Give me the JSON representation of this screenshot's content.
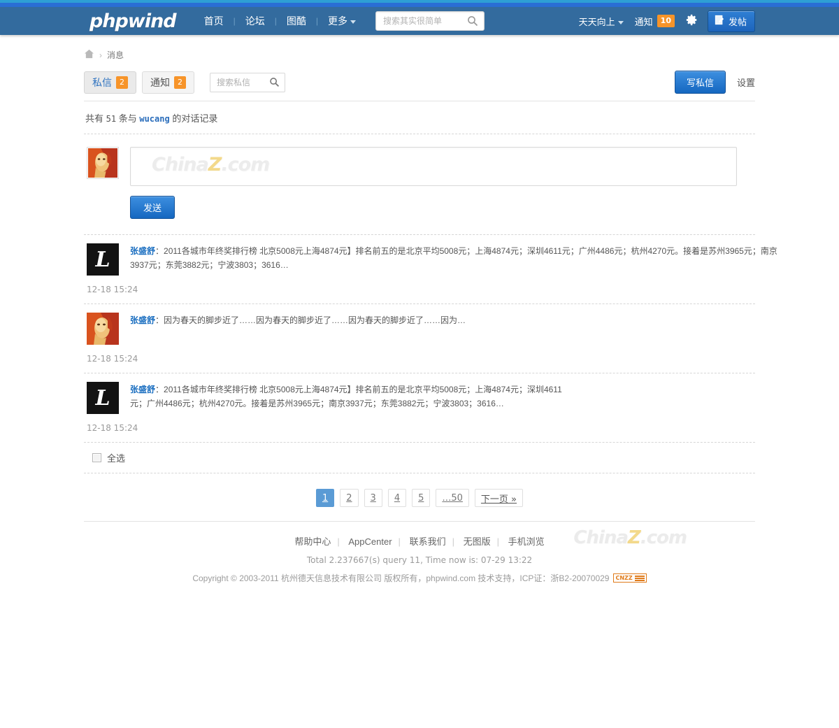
{
  "header": {
    "logo": "phpwind",
    "nav": [
      {
        "label": "首页"
      },
      {
        "label": "论坛"
      },
      {
        "label": "图酷"
      },
      {
        "label": "更多"
      }
    ],
    "search_placeholder": "搜索其实很简单",
    "search_value": "",
    "search_icon": "search-icon",
    "user": "天天向上",
    "notice_label": "通知",
    "notice_count": "10",
    "gear_icon": "gear-icon",
    "post_label": "发帖",
    "post_icon": "compose-icon",
    "colors": {
      "bar": "#336b9e",
      "strip_top": "#2e9fd4",
      "strip_mid": "#2a6ed4",
      "badge": "#f79429"
    }
  },
  "breadcrumb": {
    "home_icon": "home-icon",
    "separator": "›",
    "current": "消息"
  },
  "tabs": [
    {
      "label": "私信",
      "count": "2",
      "active": true
    },
    {
      "label": "通知",
      "count": "2",
      "active": false
    }
  ],
  "tab_search": {
    "placeholder": "搜索私信",
    "value": "",
    "icon": "search-icon"
  },
  "actions": {
    "write_label": "写私信",
    "settings_label": "设置"
  },
  "conversation": {
    "prefix": "共有",
    "count": "51",
    "middle": "条与",
    "user": "wucang",
    "suffix": "的对话记录"
  },
  "compose": {
    "avatar_alt": "user-avatar",
    "textarea_value": "",
    "watermark": "ChinaZ.com",
    "send_label": "发送"
  },
  "messages": [
    {
      "avatar_type": "letter",
      "avatar_letter": "L",
      "sender": "张盛舒",
      "colon": "：",
      "text": "2011各城市年终奖排行榜 北京5008元上海4874元】排名前五的是北京平均5008元；上海4874元；深圳4611元；广州4486元；杭州4270元。接着是苏州3965元；南京3937元；东莞3882元；宁波3803；3616…",
      "time": "12-18 15:24"
    },
    {
      "avatar_type": "photo",
      "avatar_letter": "",
      "sender": "张盛舒",
      "colon": "：",
      "text": "因为春天的脚步近了……因为春天的脚步近了……因为春天的脚步近了……因为…",
      "time": "12-18 15:24"
    },
    {
      "avatar_type": "letter",
      "avatar_letter": "L",
      "sender": "张盛舒",
      "colon": "：",
      "text": "2011各城市年终奖排行榜 北京5008元上海4874元】排名前五的是北京平均5008元；上海4874元；深圳4611元；广州4486元；杭州4270元。接着是苏州3965元；南京3937元；东莞3882元；宁波3803；3616…",
      "time": "12-18 15:24"
    }
  ],
  "select_all": {
    "label": "全选",
    "checked": false
  },
  "pagination": {
    "pages": [
      "1",
      "2",
      "3",
      "4",
      "5",
      "…50"
    ],
    "active": "1",
    "next_label": "下一页 »"
  },
  "footer": {
    "links": [
      "帮助中心",
      "AppCenter",
      "联系我们",
      "无图版",
      "手机浏览"
    ],
    "stats": "Total 2.237667(s) query 11, Time now is: 07-29 13:22",
    "copyright": "Copyright © 2003-2011 杭州德天信息技术有限公司 版权所有，phpwind.com 技术支持，ICP证：浙B2-20070029",
    "cnzz": "CNZZ",
    "watermark": "ChinaZ.com"
  }
}
